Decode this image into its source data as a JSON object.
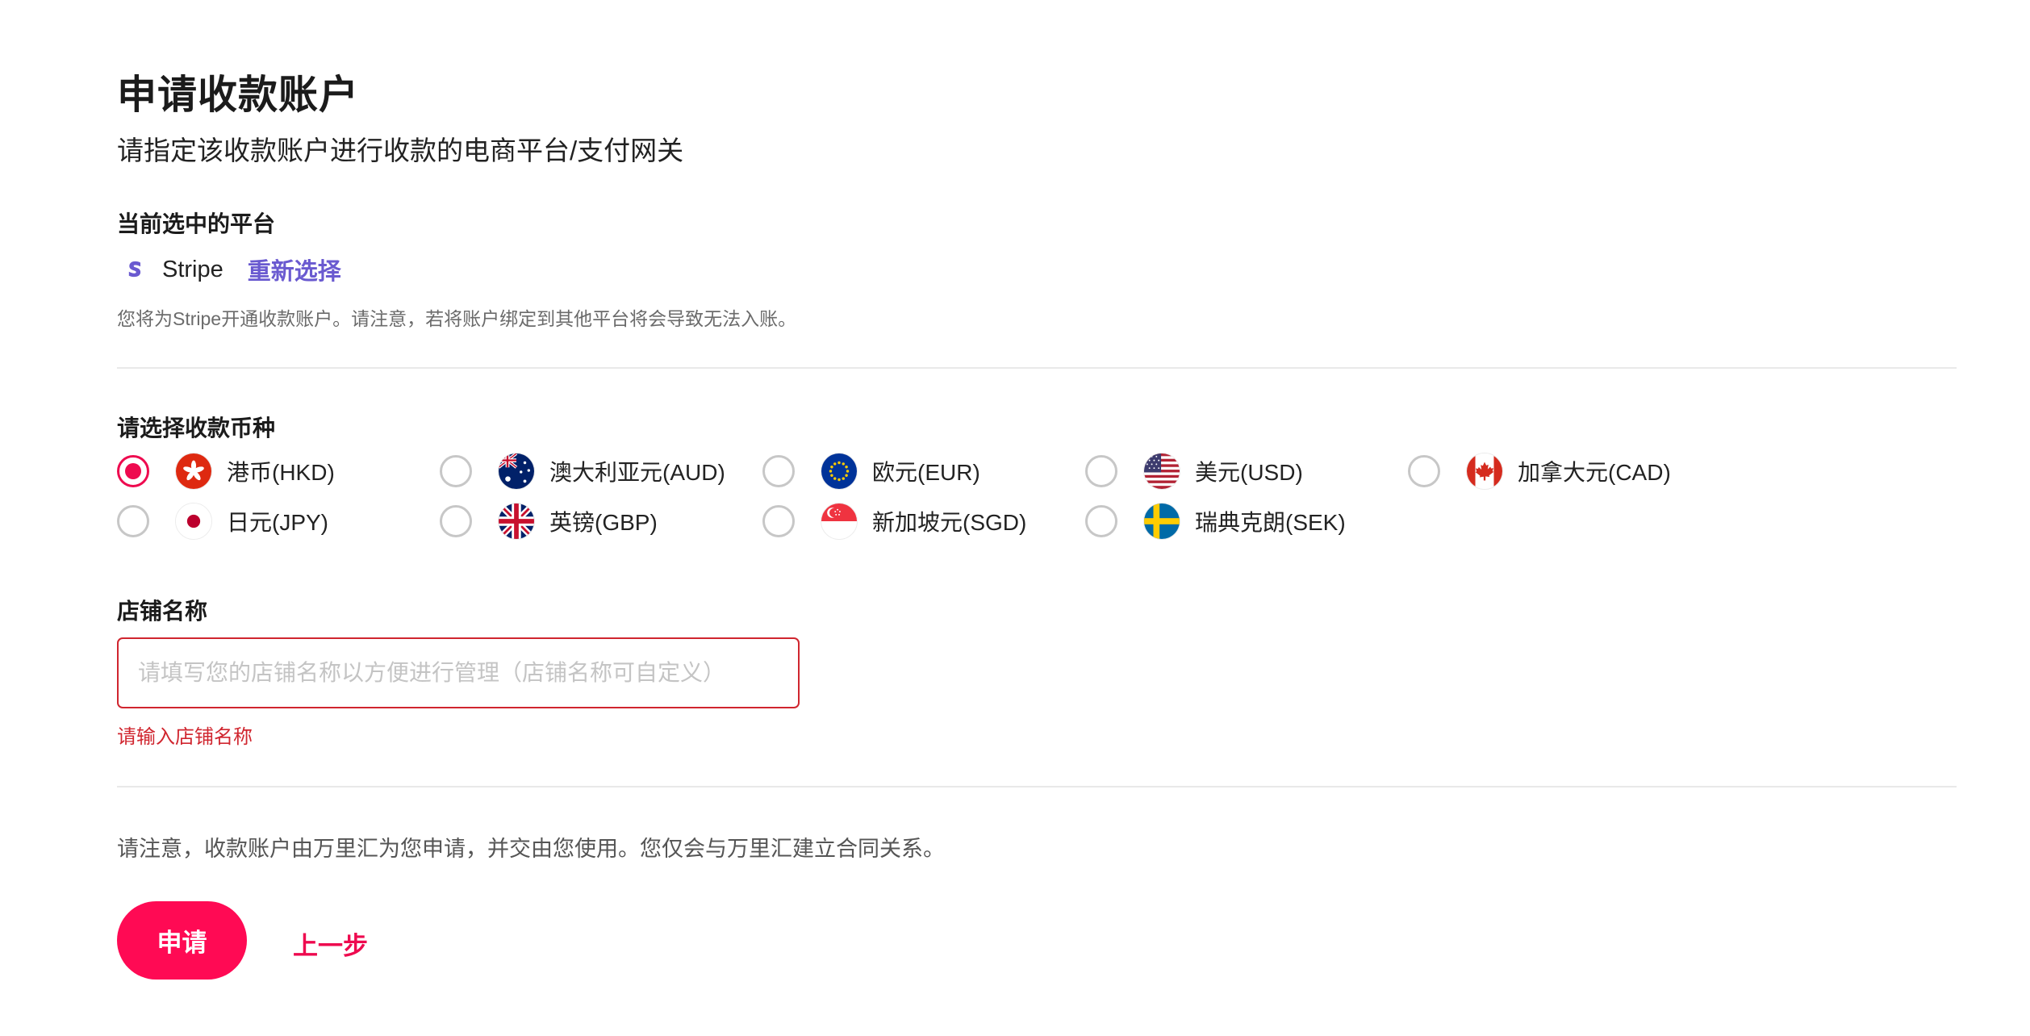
{
  "header": {
    "title": "申请收款账户",
    "subtitle": "请指定该收款账户进行收款的电商平台/支付网关"
  },
  "platform": {
    "section_label": "当前选中的平台",
    "name": "Stripe",
    "logo_icon": "stripe-logo-icon",
    "reselect_label": "重新选择",
    "note": "您将为Stripe开通收款账户。请注意，若将账户绑定到其他平台将会导致无法入账。"
  },
  "currency": {
    "section_label": "请选择收款币种",
    "options": [
      {
        "label": "港币(HKD)",
        "flag": "hk-flag-icon",
        "selected": true
      },
      {
        "label": "澳大利亚元(AUD)",
        "flag": "au-flag-icon",
        "selected": false
      },
      {
        "label": "欧元(EUR)",
        "flag": "eu-flag-icon",
        "selected": false
      },
      {
        "label": "美元(USD)",
        "flag": "us-flag-icon",
        "selected": false
      },
      {
        "label": "加拿大元(CAD)",
        "flag": "ca-flag-icon",
        "selected": false
      },
      {
        "label": "日元(JPY)",
        "flag": "jp-flag-icon",
        "selected": false
      },
      {
        "label": "英镑(GBP)",
        "flag": "gb-flag-icon",
        "selected": false
      },
      {
        "label": "新加坡元(SGD)",
        "flag": "sg-flag-icon",
        "selected": false
      },
      {
        "label": "瑞典克朗(SEK)",
        "flag": "se-flag-icon",
        "selected": false
      }
    ]
  },
  "store": {
    "section_label": "店铺名称",
    "value": "",
    "placeholder": "请填写您的店铺名称以方便进行管理（店铺名称可自定义）",
    "error": "请输入店铺名称"
  },
  "footer": {
    "note": "请注意，收款账户由万里汇为您申请，并交由您使用。您仅会与万里汇建立合同关系。",
    "apply_label": "申请",
    "back_label": "上一步"
  },
  "colors": {
    "accent": "#ff0a54",
    "error": "#d0262f",
    "link": "#6a5ad0"
  }
}
